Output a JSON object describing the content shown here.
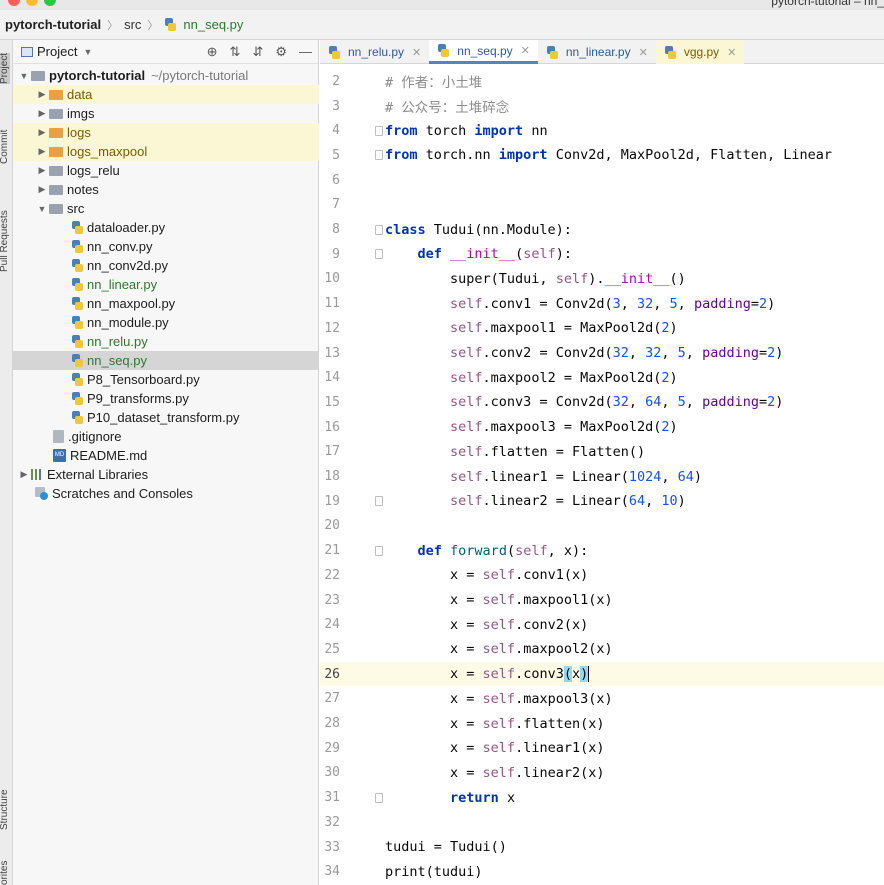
{
  "window": {
    "title": "pytorch-tutorial – nn_"
  },
  "breadcrumb": {
    "project": "pytorch-tutorial",
    "folder": "src",
    "file": "nn_seq.py"
  },
  "tool_strip": {
    "project": "Project",
    "commit": "Commit",
    "pull_requests": "Pull Requests",
    "structure": "Structure",
    "favorites": "orites"
  },
  "project_panel": {
    "title": "Project",
    "tree": [
      {
        "name": "pytorch-tutorial",
        "path": "~/pytorch-tutorial"
      },
      {
        "name": "data"
      },
      {
        "name": "imgs"
      },
      {
        "name": "logs"
      },
      {
        "name": "logs_maxpool"
      },
      {
        "name": "logs_relu"
      },
      {
        "name": "notes"
      },
      {
        "name": "src"
      },
      {
        "name": "dataloader.py"
      },
      {
        "name": "nn_conv.py"
      },
      {
        "name": "nn_conv2d.py"
      },
      {
        "name": "nn_linear.py"
      },
      {
        "name": "nn_maxpool.py"
      },
      {
        "name": "nn_module.py"
      },
      {
        "name": "nn_relu.py"
      },
      {
        "name": "nn_seq.py"
      },
      {
        "name": "P8_Tensorboard.py"
      },
      {
        "name": "P9_transforms.py"
      },
      {
        "name": "P10_dataset_transform.py"
      },
      {
        "name": ".gitignore"
      },
      {
        "name": "README.md"
      },
      {
        "name": "External Libraries"
      },
      {
        "name": "Scratches and Consoles"
      }
    ]
  },
  "tabs": [
    {
      "label": "nn_relu.py"
    },
    {
      "label": "nn_seq.py"
    },
    {
      "label": "nn_linear.py"
    },
    {
      "label": "vgg.py"
    }
  ],
  "editor": {
    "line_numbers": [
      "2",
      "3",
      "4",
      "5",
      "6",
      "7",
      "8",
      "9",
      "10",
      "11",
      "12",
      "13",
      "14",
      "15",
      "16",
      "17",
      "18",
      "19",
      "20",
      "21",
      "22",
      "23",
      "24",
      "25",
      "26",
      "27",
      "28",
      "29",
      "30",
      "31",
      "32",
      "33",
      "34"
    ],
    "lines": {
      "l2": "# 作者：小土堆",
      "l3": "# 公众号：土堆碎念",
      "l4a": "from",
      "l4b": " torch ",
      "l4c": "import",
      "l4d": " nn",
      "l5a": "from",
      "l5b": " torch.nn ",
      "l5c": "import",
      "l5d": " Conv2d, MaxPool2d, Flatten, Linear",
      "l8a": "class",
      "l8b": " Tudui(nn.Module):",
      "l9a": "def",
      "l9b": "__init__",
      "l9c": "self",
      "l10a": "super(Tudui, ",
      "l10b": "self",
      "l10c": ").",
      "l10d": "__init__",
      "l10e": "()",
      "c1": "self",
      "c1b": ".conv1 = Conv2d(",
      "c1n1": "3",
      "c1n2": "32",
      "c1n3": "5",
      "pad": "padding",
      "c1n4": "2",
      "m1": ".maxpool1 = MaxPool2d(",
      "m1n": "2",
      "c2": ".conv2 = Conv2d(",
      "c2n1": "32",
      "c2n2": "32",
      "c2n3": "5",
      "c2n4": "2",
      "m2": ".maxpool2 = MaxPool2d(",
      "m2n": "2",
      "c3": ".conv3 = Conv2d(",
      "c3n1": "32",
      "c3n2": "64",
      "c3n3": "5",
      "c3n4": "2",
      "m3": ".maxpool3 = MaxPool2d(",
      "m3n": "2",
      "fl": ".flatten = Flatten()",
      "li1": ".linear1 = Linear(",
      "li1n1": "1024",
      "li1n2": "64",
      "li2": ".linear2 = Linear(",
      "li2n1": "64",
      "li2n2": "10",
      "fwd_def": "def",
      "fwd_name": "forward",
      "fwd_self": "self",
      "fwd_x": ", x):",
      "f_conv1": ".conv1(x)",
      "f_mp1": ".maxpool1(x)",
      "f_conv2": ".conv2(x)",
      "f_mp2": ".maxpool2(x)",
      "f_conv3": ".conv3",
      "f_mp3": ".maxpool3(x)",
      "f_flat": ".flatten(x)",
      "f_lin1": ".linear1(x)",
      "f_lin2": ".linear2(x)",
      "ret": "return",
      "ret_x": " x",
      "l33": "tudui = Tudui()",
      "l34": "print(tudui)"
    }
  }
}
